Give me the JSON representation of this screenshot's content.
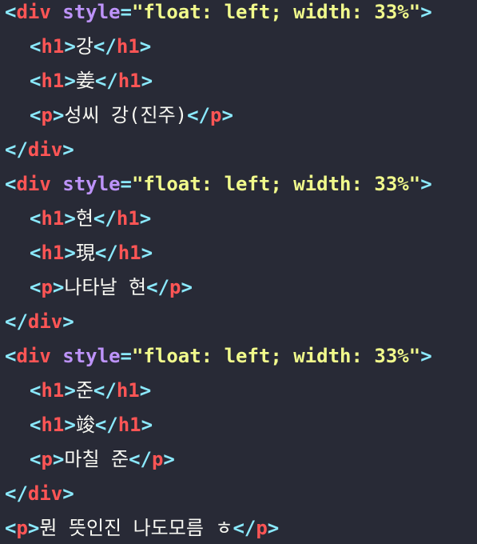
{
  "code": {
    "tags": {
      "div": "div",
      "h1": "h1",
      "p": "p",
      "style_attr": "style",
      "style_value": "float: left; width: 33%"
    },
    "blocks": [
      {
        "h1_a": "강",
        "h1_b": "姜",
        "p": "성씨 강(진주)"
      },
      {
        "h1_a": "현",
        "h1_b": "現",
        "p": "나타날 현"
      },
      {
        "h1_a": "준",
        "h1_b": "竣",
        "p": "마칠 준"
      }
    ],
    "final_p": "뭔 뜻인진 나도모름 ㅎ"
  }
}
